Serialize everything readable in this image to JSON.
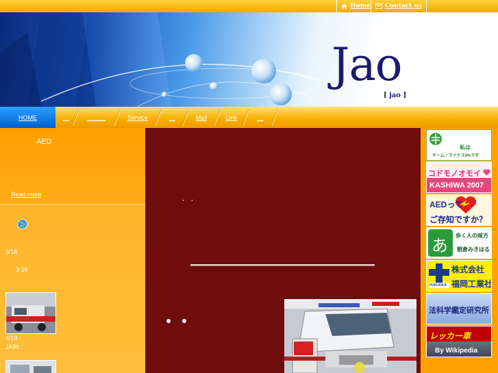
{
  "header": {
    "home_label": "Home",
    "contact_label": "Contact us",
    "brand": "Jao",
    "brand_sub": "[ jao ]"
  },
  "nav": {
    "items": [
      {
        "label": "HOME"
      },
      {
        "label": "＿"
      },
      {
        "label": "＿＿＿"
      },
      {
        "label": "Service"
      },
      {
        "label": "＿"
      },
      {
        "label": "Mail"
      },
      {
        "label": "Link"
      },
      {
        "label": "＿"
      }
    ]
  },
  "left": {
    "aed_title": "AED",
    "read_more": "Read more",
    "date1": "3/16",
    "date1_sub": "3 16",
    "date2": "4/19",
    "date2_sub": "JARI"
  },
  "center": {
    "dots_text": "・ ・"
  },
  "right": {
    "banners": [
      {
        "line1": "私は",
        "line2": "チーム・マイナス6%です"
      },
      {
        "line1": "コドモノオモイ",
        "line2": "KASHIWA 2007"
      },
      {
        "line1": "AEDって",
        "line2": "ご存知ですか？"
      },
      {
        "line1": "歩く人の味方",
        "line2": "朝倉みきはる",
        "glyph": "あ"
      },
      {
        "line1": "株式会社",
        "line2": "福岡工業社",
        "logo": "FUKUOKA"
      },
      {
        "line1": "法科学鑑定研究所"
      },
      {
        "line1": "レッカー車",
        "line2": "By Wikipedia"
      }
    ]
  },
  "colors": {
    "orange": "#ffa200",
    "maroon": "#6e0d0c",
    "navy_brand": "#1a1a6e",
    "nav_home_blue": "#0060d0"
  },
  "icons": [
    "house-icon",
    "mail-icon",
    "globe-icon",
    "heart-icon",
    "cross-icon"
  ]
}
